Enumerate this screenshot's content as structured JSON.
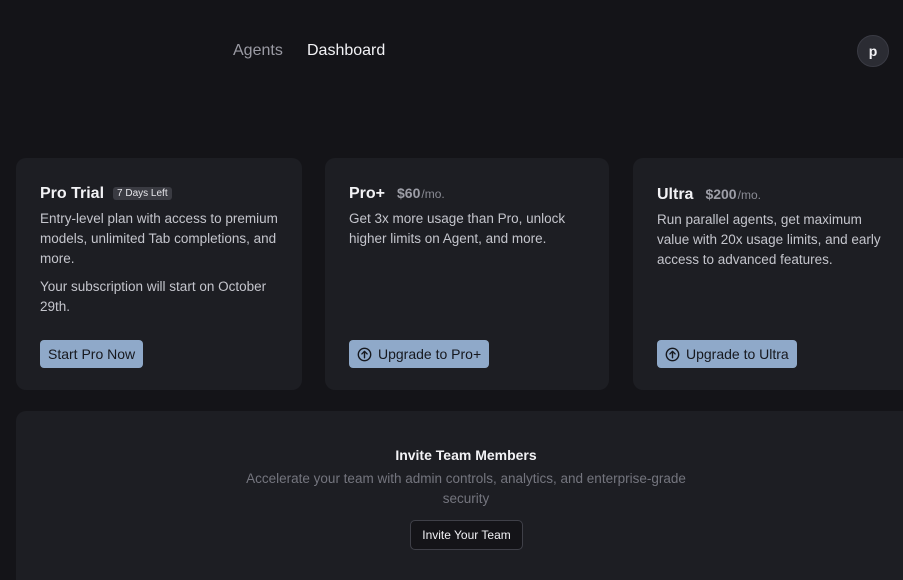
{
  "nav": {
    "links": [
      {
        "label": "Agents"
      },
      {
        "label": "Dashboard"
      }
    ],
    "avatar_initial": "p"
  },
  "plans": [
    {
      "name": "Pro Trial",
      "badge": "7 Days Left",
      "description": "Entry-level plan with access to premium models, unlimited Tab completions, and more.",
      "note": "Your subscription will start on October 29th.",
      "button_label": "Start Pro Now"
    },
    {
      "name": "Pro+",
      "price": "$60",
      "period": "/mo.",
      "description": "Get 3x more usage than Pro, unlock higher limits on Agent, and more.",
      "button_label": "Upgrade to Pro+",
      "button_icon": "arrow-up-circle-icon"
    },
    {
      "name": "Ultra",
      "price": "$200",
      "period": "/mo.",
      "description": "Run parallel agents, get maximum value with 20x usage limits, and early access to advanced features.",
      "button_label": "Upgrade to Ultra",
      "button_icon": "arrow-up-circle-icon"
    }
  ],
  "invite": {
    "title": "Invite Team Members",
    "subtitle": "Accelerate your team with admin controls, analytics, and enterprise-grade security",
    "button_label": "Invite Your Team"
  },
  "colors": {
    "background": "#141418",
    "card": "#1d1e23",
    "accent_button": "#8fa9c9"
  }
}
